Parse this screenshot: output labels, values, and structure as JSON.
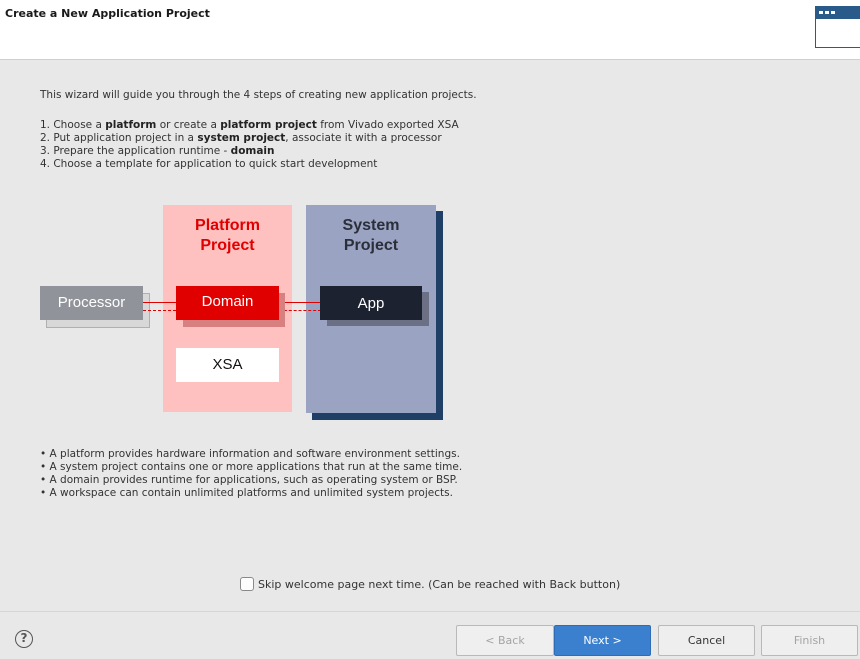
{
  "header": {
    "title": "Create a New Application Project"
  },
  "intro": "This wizard will guide you through the 4 steps of creating new application projects.",
  "steps": [
    {
      "pre": "1.  Choose a ",
      "b1": "platform",
      "mid": " or create a ",
      "b2": "platform project",
      "post": " from Vivado exported XSA"
    },
    {
      "pre": "2.  Put application project in a ",
      "b1": "system project",
      "mid": ", associate it with a processor",
      "b2": "",
      "post": ""
    },
    {
      "pre": "3.  Prepare the application runtime - ",
      "b1": "domain",
      "mid": "",
      "b2": "",
      "post": ""
    },
    {
      "pre": "4.  Choose a template for application to quick start development",
      "b1": "",
      "mid": "",
      "b2": "",
      "post": ""
    }
  ],
  "diagram": {
    "platform_line1": "Platform",
    "platform_line2": "Project",
    "system_line1": "System",
    "system_line2": "Project",
    "processor": "Processor",
    "domain": "Domain",
    "xsa": "XSA",
    "app": "App"
  },
  "bullets": [
    "• A platform provides hardware information and software environment settings.",
    "• A system project contains one or more applications that run at the same time.",
    "• A domain provides runtime for applications, such as operating system or BSP.",
    "• A workspace can contain unlimited platforms and unlimited system projects."
  ],
  "skip_label": "Skip welcome page next time. (Can be reached with Back button)",
  "skip_checked": false,
  "buttons": {
    "back": "< Back",
    "next": "Next >",
    "cancel": "Cancel",
    "finish": "Finish"
  },
  "help_glyph": "?",
  "colors": {
    "platform_bg": "#ffc0c0",
    "platform_text": "#e00000",
    "domain_bg": "#e00000",
    "system_bg": "#9aa3c2",
    "system_shadow": "#1f3f66",
    "app_bg": "#1c2230",
    "processor_bg": "#909399",
    "primary_button": "#3b80cf"
  }
}
